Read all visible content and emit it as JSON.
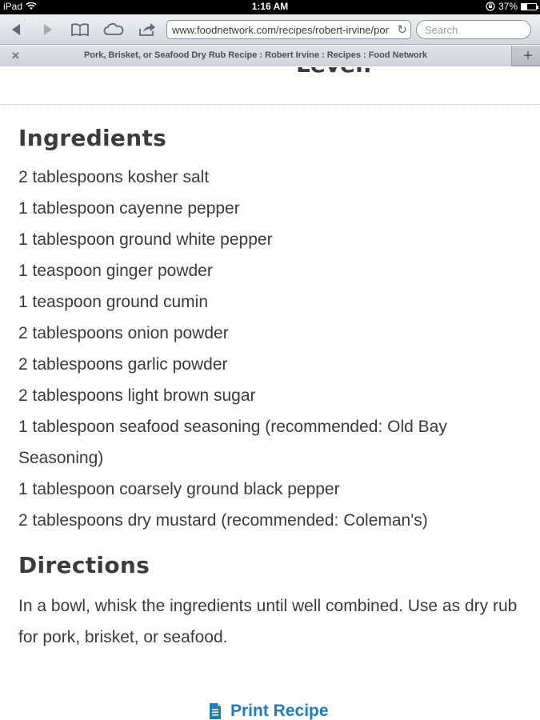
{
  "status_bar": {
    "device": "iPad",
    "time": "1:16 AM",
    "battery": "37%",
    "battery_level": 0.37
  },
  "browser": {
    "url": "www.foodnetwork.com/recipes/robert-irvine/por",
    "search_placeholder": "Search",
    "tab_title": "Pork, Brisket, or Seafood Dry Rub Recipe : Robert Irvine : Recipes : Food Network"
  },
  "page": {
    "cutoff_heading": "Level:",
    "ingredients_heading": "Ingredients",
    "ingredients": [
      "2 tablespoons kosher salt",
      "1 tablespoon cayenne pepper",
      "1 tablespoon ground white pepper",
      "1 teaspoon ginger powder",
      "1 teaspoon ground cumin",
      "2 tablespoons onion powder",
      "2 tablespoons garlic powder",
      "2 tablespoons light brown sugar",
      "1 tablespoon seafood seasoning (recommended: Old Bay Seasoning)",
      "1 tablespoon coarsely ground black pepper",
      "2 tablespoons dry mustard (recommended: Coleman's)"
    ],
    "directions_heading": "Directions",
    "directions": "In a bowl, whisk the ingredients until well combined. Use as dry rub for pork, brisket, or seafood.",
    "print_label": "Print Recipe"
  },
  "colors": {
    "link": "#1e7fb8",
    "text": "#3a3a3a"
  }
}
